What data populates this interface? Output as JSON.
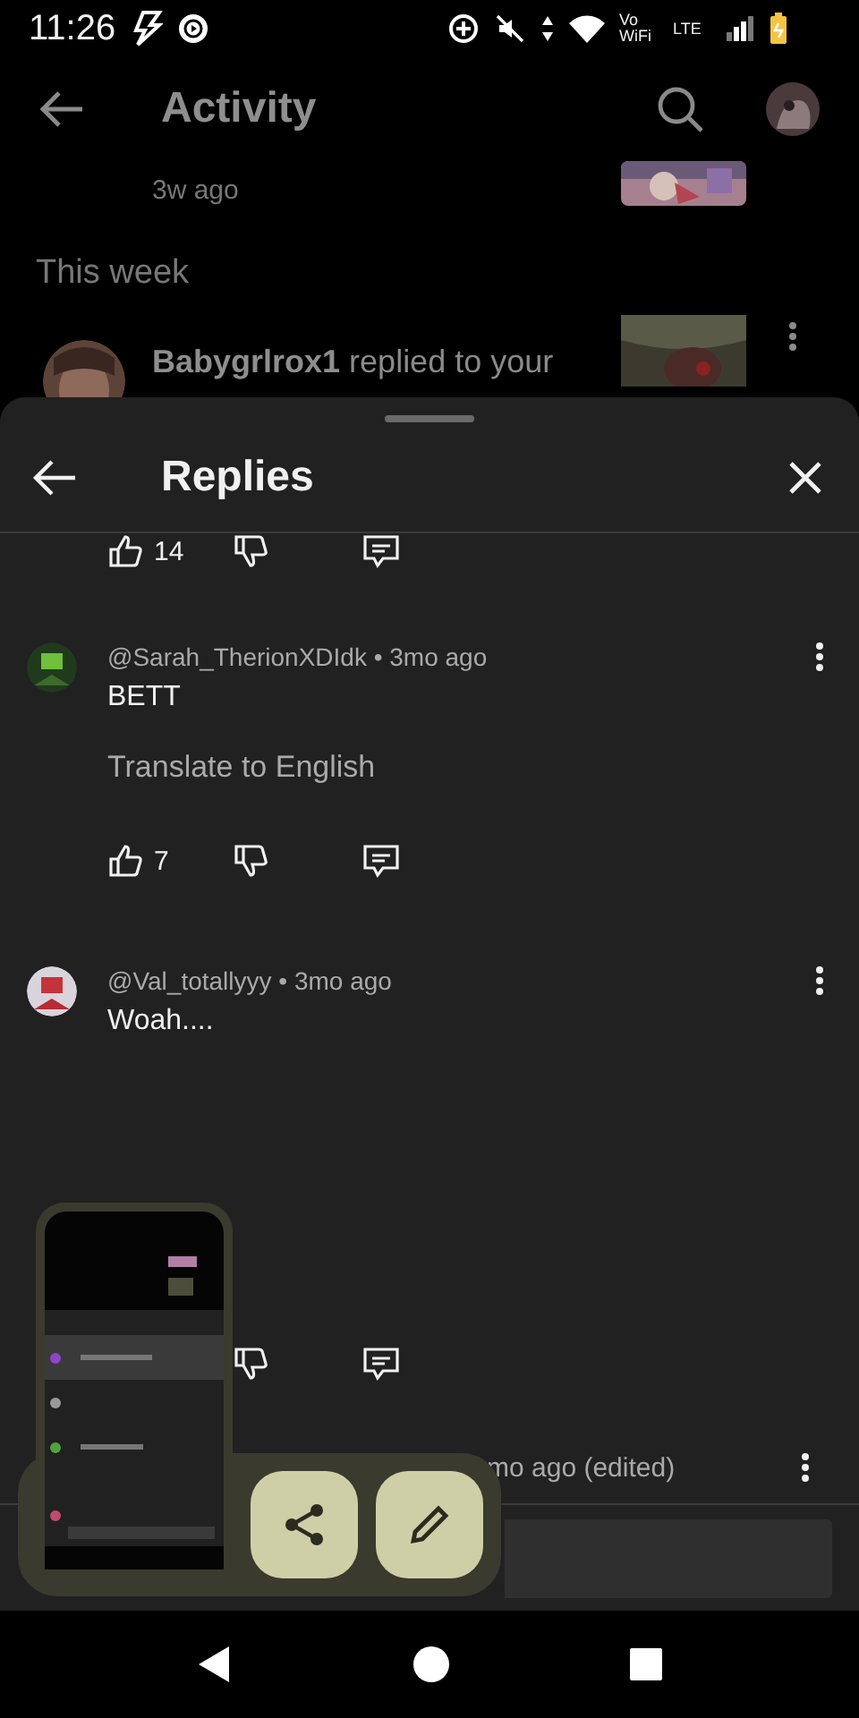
{
  "status_bar": {
    "time": "11:26",
    "network_label": "Vo WiFi",
    "network_type": "LTE"
  },
  "background": {
    "title": "Activity",
    "time": "3w ago",
    "section": "This week",
    "notification": {
      "author": "Babygrlrox1",
      "text": "replied to your"
    }
  },
  "sheet": {
    "title": "Replies",
    "top_actions": {
      "likes": "14"
    },
    "comments": [
      {
        "meta": "@Sarah_TherionXDIdk • 3mo ago",
        "text": "BETT",
        "translate": "Translate to English",
        "likes": "7"
      },
      {
        "meta": "@Val_totallyyy • 3mo ago",
        "text": "Woah...."
      }
    ],
    "partial_comment": {
      "time": "mo ago (edited)"
    }
  },
  "overlay": {
    "kind": "screenshot_preview"
  }
}
